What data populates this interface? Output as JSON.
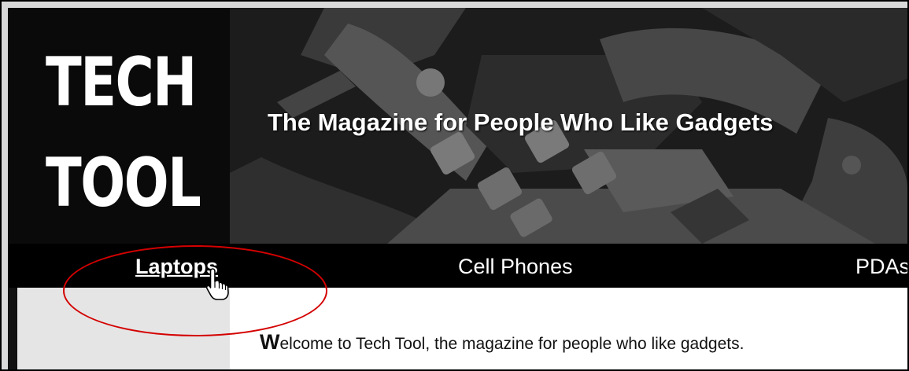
{
  "header": {
    "logo_line1": "TECH",
    "logo_line2": "TOOL",
    "tagline": "The Magazine for People Who Like Gadgets"
  },
  "nav": {
    "items": [
      {
        "label": "Laptops",
        "active": true
      },
      {
        "label": "Cell Phones",
        "active": false
      },
      {
        "label": "PDAs",
        "active": false
      }
    ]
  },
  "content": {
    "welcome_dropcap": "W",
    "welcome_rest": "elcome to Tech Tool, the magazine for people who like gadgets."
  },
  "annotation": {
    "highlight_color": "#d40000",
    "cursor_icon": "hand-pointer-icon"
  },
  "colors": {
    "header_bg": "#0a0a0a",
    "nav_bg": "#000000",
    "sidebar_bg": "#e5e5e5",
    "content_bg": "#ffffff"
  }
}
